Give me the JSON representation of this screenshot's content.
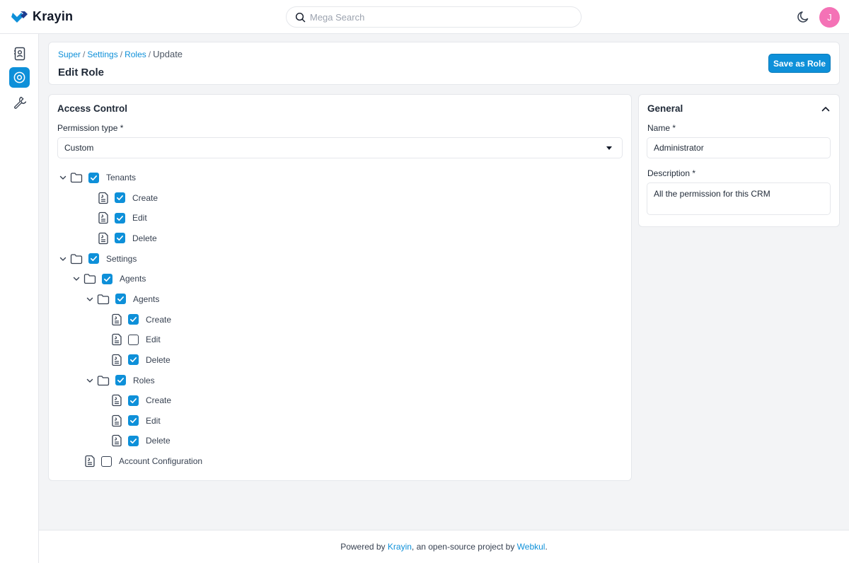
{
  "app": {
    "name": "Krayin",
    "brand_color": "#0e90d9"
  },
  "search": {
    "placeholder": "Mega Search",
    "value": ""
  },
  "user": {
    "initial": "J",
    "avatar_color": "#f472b6"
  },
  "sidebar": {
    "items": [
      {
        "icon": "contacts-icon"
      },
      {
        "icon": "settings-icon",
        "active": true
      },
      {
        "icon": "wrench-icon"
      }
    ]
  },
  "breadcrumb": {
    "items": [
      "Super",
      "Settings",
      "Roles"
    ],
    "current": "Update"
  },
  "page": {
    "title": "Edit Role",
    "save_label": "Save as Role"
  },
  "access_control": {
    "title": "Access Control",
    "permission_type_label": "Permission type *",
    "permission_type_value": "Custom",
    "tree": [
      {
        "label": "Tenants",
        "type": "folder",
        "checked": true
      },
      {
        "label": "Create",
        "type": "file",
        "checked": true
      },
      {
        "label": "Edit",
        "type": "file",
        "checked": true
      },
      {
        "label": "Delete",
        "type": "file",
        "checked": true
      },
      {
        "label": "Settings",
        "type": "folder",
        "checked": true
      },
      {
        "label": "Agents",
        "type": "folder",
        "checked": true
      },
      {
        "label": "Agents",
        "type": "folder",
        "checked": true
      },
      {
        "label": "Create",
        "type": "file",
        "checked": true
      },
      {
        "label": "Edit",
        "type": "file",
        "checked": false
      },
      {
        "label": "Delete",
        "type": "file",
        "checked": true
      },
      {
        "label": "Roles",
        "type": "folder",
        "checked": true
      },
      {
        "label": "Create",
        "type": "file",
        "checked": true
      },
      {
        "label": "Edit",
        "type": "file",
        "checked": true
      },
      {
        "label": "Delete",
        "type": "file",
        "checked": true
      },
      {
        "label": "Account Configuration",
        "type": "file",
        "checked": false
      }
    ]
  },
  "general": {
    "title": "General",
    "name_label": "Name *",
    "name_value": "Administrator",
    "description_label": "Description *",
    "description_value": "All the permission for this CRM"
  },
  "footer": {
    "prefix": "Powered by ",
    "link1": "Krayin",
    "middle": ", an open-source project by ",
    "link2": "Webkul",
    "suffix": "."
  }
}
